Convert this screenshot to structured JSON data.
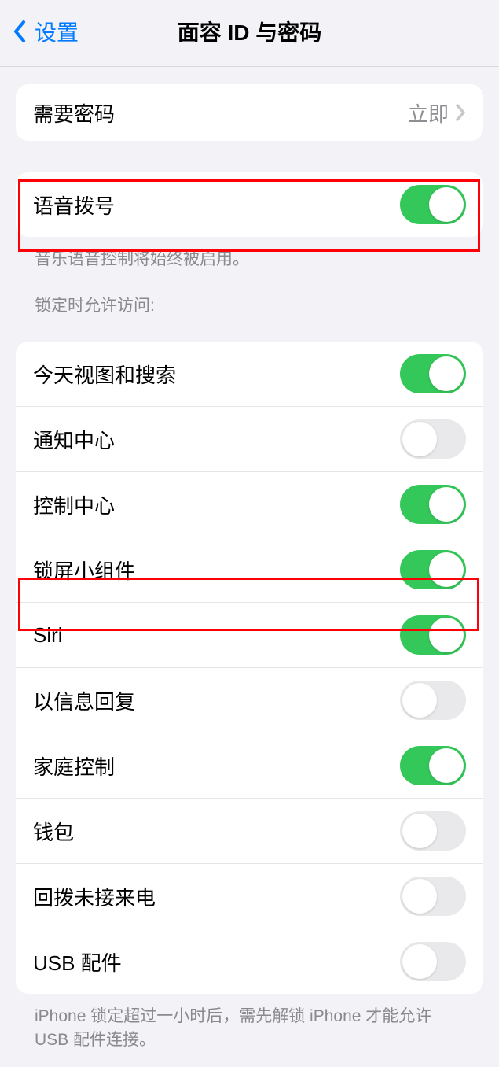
{
  "nav": {
    "back_label": "设置",
    "title": "面容 ID 与密码"
  },
  "passcode_group": {
    "label": "需要密码",
    "value": "立即"
  },
  "voice_dial": {
    "label": "语音拨号",
    "on": true,
    "footer": "音乐语音控制将始终被启用。"
  },
  "lock_section": {
    "header": "锁定时允许访问:",
    "items": [
      {
        "label": "今天视图和搜索",
        "on": true
      },
      {
        "label": "通知中心",
        "on": false
      },
      {
        "label": "控制中心",
        "on": true
      },
      {
        "label": "锁屏小组件",
        "on": true
      },
      {
        "label": "Siri",
        "on": true
      },
      {
        "label": "以信息回复",
        "on": false
      },
      {
        "label": "家庭控制",
        "on": true
      },
      {
        "label": "钱包",
        "on": false
      },
      {
        "label": "回拨未接来电",
        "on": false
      },
      {
        "label": "USB 配件",
        "on": false
      }
    ],
    "footer": "iPhone 锁定超过一小时后，需先解锁 iPhone 才能允许 USB 配件连接。"
  }
}
